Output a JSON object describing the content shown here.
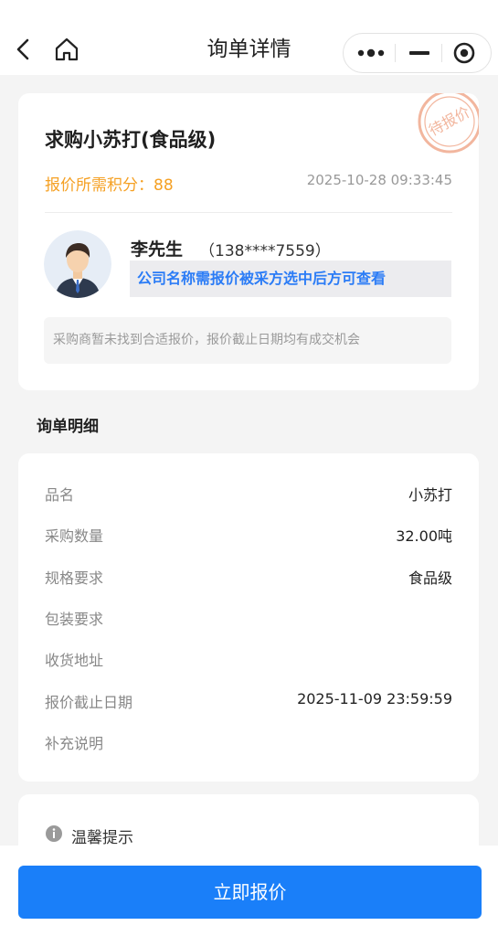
{
  "nav": {
    "title": "询单详情"
  },
  "inquiry": {
    "product_title": "求购小苏打(食品级)",
    "points_text": "报价所需积分：88",
    "time": "2025-10-28 09:33:45",
    "stamp_text": "待报价",
    "contact_name": "李先生",
    "contact_phone": "（138****7559）",
    "company_hidden_text": "公司名称需报价被采方选中后方可查看",
    "notice": "采购商暂未找到合适报价，报价截止日期均有成交机会"
  },
  "details": {
    "section_title": "询单明细",
    "rows": [
      {
        "label": "品名",
        "value": "小苏打"
      },
      {
        "label": "采购数量",
        "value": "32.00吨"
      },
      {
        "label": "规格要求",
        "value": "食品级"
      },
      {
        "label": "包装要求",
        "value": ""
      },
      {
        "label": "收货地址",
        "value": ""
      },
      {
        "label": "报价截止日期",
        "value": "2025-11-09 23:59:59"
      },
      {
        "label": "补充说明",
        "value": ""
      }
    ]
  },
  "tip": {
    "title": "温馨提示"
  },
  "footer": {
    "button_label": "立即报价"
  },
  "colors": {
    "primary": "#1a7ff9",
    "points": "#f5a023",
    "company_text": "#2b7cf6",
    "stamp": "#f2b69e"
  }
}
